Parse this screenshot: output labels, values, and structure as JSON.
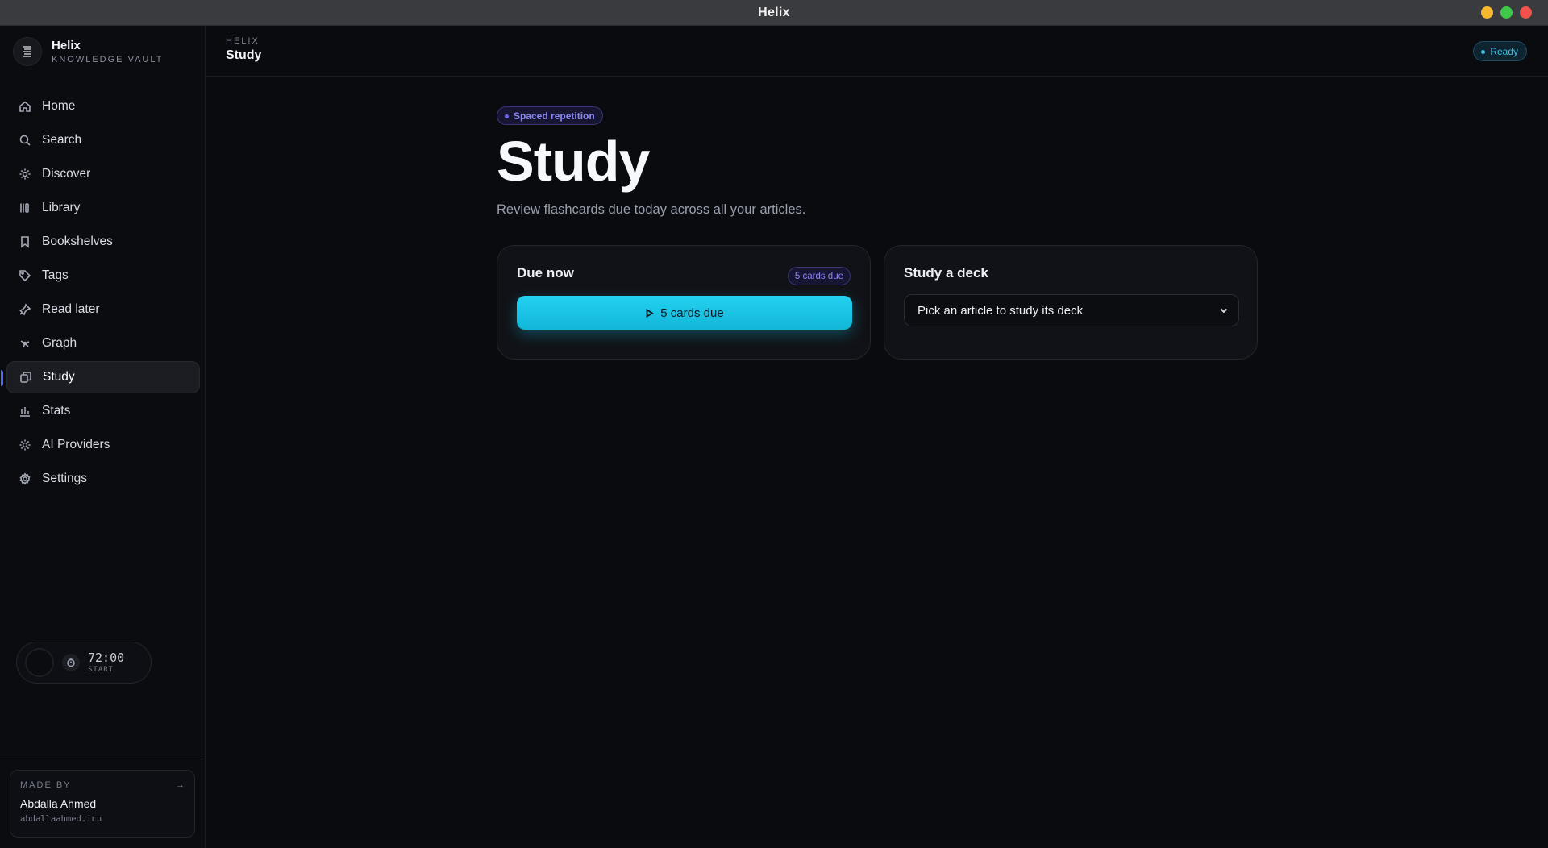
{
  "window": {
    "title": "Helix"
  },
  "brand": {
    "name": "Helix",
    "subtitle": "KNOWLEDGE VAULT"
  },
  "sidebar": {
    "items": [
      {
        "label": "Home",
        "icon": "home-icon"
      },
      {
        "label": "Search",
        "icon": "search-icon"
      },
      {
        "label": "Discover",
        "icon": "sparkle-icon"
      },
      {
        "label": "Library",
        "icon": "library-icon"
      },
      {
        "label": "Bookshelves",
        "icon": "bookmark-icon"
      },
      {
        "label": "Tags",
        "icon": "tag-icon"
      },
      {
        "label": "Read later",
        "icon": "pin-icon"
      },
      {
        "label": "Graph",
        "icon": "graph-icon"
      },
      {
        "label": "Study",
        "icon": "cards-icon",
        "active": true
      },
      {
        "label": "Stats",
        "icon": "bar-chart-icon"
      },
      {
        "label": "AI Providers",
        "icon": "sparkle-icon"
      },
      {
        "label": "Settings",
        "icon": "gear-icon"
      }
    ],
    "timer": {
      "time": "72:00",
      "label": "START"
    },
    "made_by": {
      "label": "MADE BY",
      "name": "Abdalla Ahmed",
      "url": "abdallaahmed.icu",
      "arrow": "→"
    }
  },
  "header": {
    "breadcrumb": "HELIX",
    "title": "Study",
    "status": "Ready"
  },
  "main": {
    "tag": "Spaced repetition",
    "title": "Study",
    "subtitle": "Review flashcards due today across all your articles.",
    "due_card": {
      "title": "Due now",
      "badge": "5 cards due",
      "button_label": "5 cards due"
    },
    "deck_card": {
      "title": "Study a deck",
      "select_value": "Pick an article to study its deck"
    }
  },
  "colors": {
    "accent": "#12b6d8",
    "brand_violet": "#8d87f0",
    "active_indicator": "#4f6bff"
  }
}
